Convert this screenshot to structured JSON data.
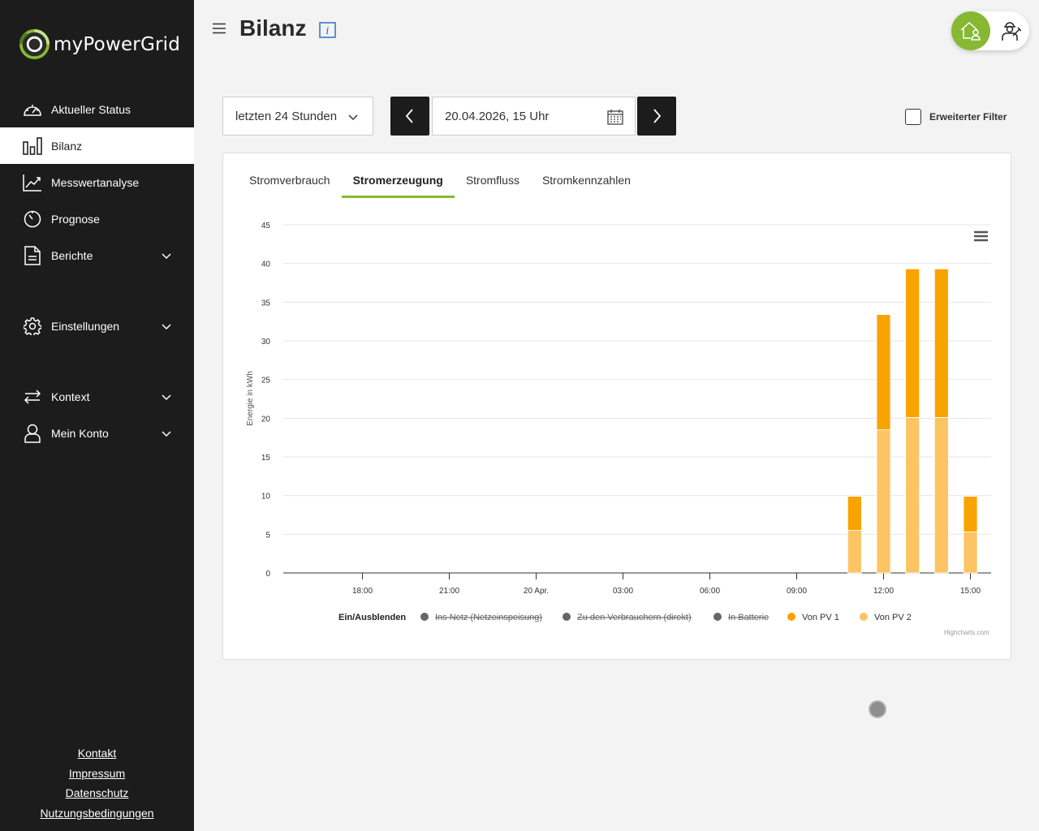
{
  "brand": {
    "name": "myPowerGrid",
    "accent": "#86b833"
  },
  "sidebar": {
    "items": [
      {
        "label": "Aktueller Status",
        "icon": "gauge-icon",
        "active": false,
        "expandable": false
      },
      {
        "label": "Bilanz",
        "icon": "bar-chart-icon",
        "active": true,
        "expandable": false
      },
      {
        "label": "Messwertanalyse",
        "icon": "trend-line-icon",
        "active": false,
        "expandable": false
      },
      {
        "label": "Prognose",
        "icon": "timer-icon",
        "active": false,
        "expandable": false
      },
      {
        "label": "Berichte",
        "icon": "document-icon",
        "active": false,
        "expandable": true
      },
      {
        "label": "Einstellungen",
        "icon": "gear-icon",
        "active": false,
        "expandable": true
      },
      {
        "label": "Kontext",
        "icon": "swap-arrows-icon",
        "active": false,
        "expandable": true
      },
      {
        "label": "Mein Konto",
        "icon": "user-icon",
        "active": false,
        "expandable": true
      }
    ],
    "footer": [
      "Kontakt",
      "Impressum",
      "Datenschutz",
      "Nutzungsbedingungen"
    ]
  },
  "header": {
    "title": "Bilanz"
  },
  "filters": {
    "period": "letzten 24 Stunden",
    "date": "20.04.2026, 15 Uhr",
    "extended_filter_label": "Erweiterter Filter",
    "extended_filter_checked": false
  },
  "tabs": [
    {
      "label": "Stromverbrauch",
      "active": false
    },
    {
      "label": "Stromerzeugung",
      "active": true
    },
    {
      "label": "Stromfluss",
      "active": false
    },
    {
      "label": "Stromkennzahlen",
      "active": false
    }
  ],
  "chart_data": {
    "type": "bar",
    "stacked": true,
    "ylabel": "Energie in kWh",
    "ylim": [
      0,
      45
    ],
    "yticks": [
      0,
      5,
      10,
      15,
      20,
      25,
      30,
      35,
      40,
      45
    ],
    "x_hours": [
      16,
      17,
      18,
      19,
      20,
      21,
      22,
      23,
      24,
      25,
      26,
      27,
      28,
      29,
      30,
      31,
      32,
      33,
      34,
      35,
      36,
      37,
      38,
      39
    ],
    "xticks": [
      {
        "hour": 18,
        "label": "18:00"
      },
      {
        "hour": 21,
        "label": "21:00"
      },
      {
        "hour": 24,
        "label": "20 Apr."
      },
      {
        "hour": 27,
        "label": "03:00"
      },
      {
        "hour": 30,
        "label": "06:00"
      },
      {
        "hour": 33,
        "label": "09:00"
      },
      {
        "hour": 36,
        "label": "12:00"
      },
      {
        "hour": 39,
        "label": "15:00"
      }
    ],
    "series": [
      {
        "name": "Ins Netz (Netzeinspeisung)",
        "color": "#666666",
        "visible": false,
        "values": [
          0,
          0,
          0,
          0,
          0,
          0,
          0,
          0,
          0,
          0,
          0,
          0,
          0,
          0,
          0,
          0,
          0,
          0,
          0,
          0,
          0,
          0,
          0,
          0
        ]
      },
      {
        "name": "Zu den Verbrauchern (direkt)",
        "color": "#666666",
        "visible": false,
        "values": [
          0,
          0,
          0,
          0,
          0,
          0,
          0,
          0,
          0,
          0,
          0,
          0,
          0,
          0,
          0,
          0,
          0,
          0,
          0,
          0,
          0,
          0,
          0,
          0
        ]
      },
      {
        "name": "In Batterie",
        "color": "#666666",
        "visible": false,
        "values": [
          0,
          0,
          0,
          0,
          0,
          0,
          0,
          0,
          0,
          0,
          0,
          0,
          0,
          0,
          0,
          0,
          0,
          0,
          0,
          0,
          0,
          0,
          0,
          0
        ]
      },
      {
        "name": "Von PV 1",
        "color": "#f9a300",
        "visible": true,
        "values": [
          0,
          0,
          0,
          0,
          0,
          0,
          0,
          0,
          0,
          0,
          0,
          0,
          0,
          0,
          0,
          0,
          0,
          0,
          0,
          4.4,
          14.9,
          19.2,
          19.2,
          4.6
        ]
      },
      {
        "name": "Von PV 2",
        "color": "#fcc462",
        "visible": true,
        "values": [
          0,
          0,
          0,
          0,
          0,
          0,
          0,
          0,
          0,
          0,
          0,
          0,
          0,
          0,
          0,
          0,
          0,
          0,
          0,
          5.5,
          18.5,
          20.1,
          20.1,
          5.3
        ]
      }
    ],
    "legend_title": "Ein/Ausblenden",
    "legend_placement": "bottom",
    "credits": "Highcharts.com",
    "grid": true
  }
}
